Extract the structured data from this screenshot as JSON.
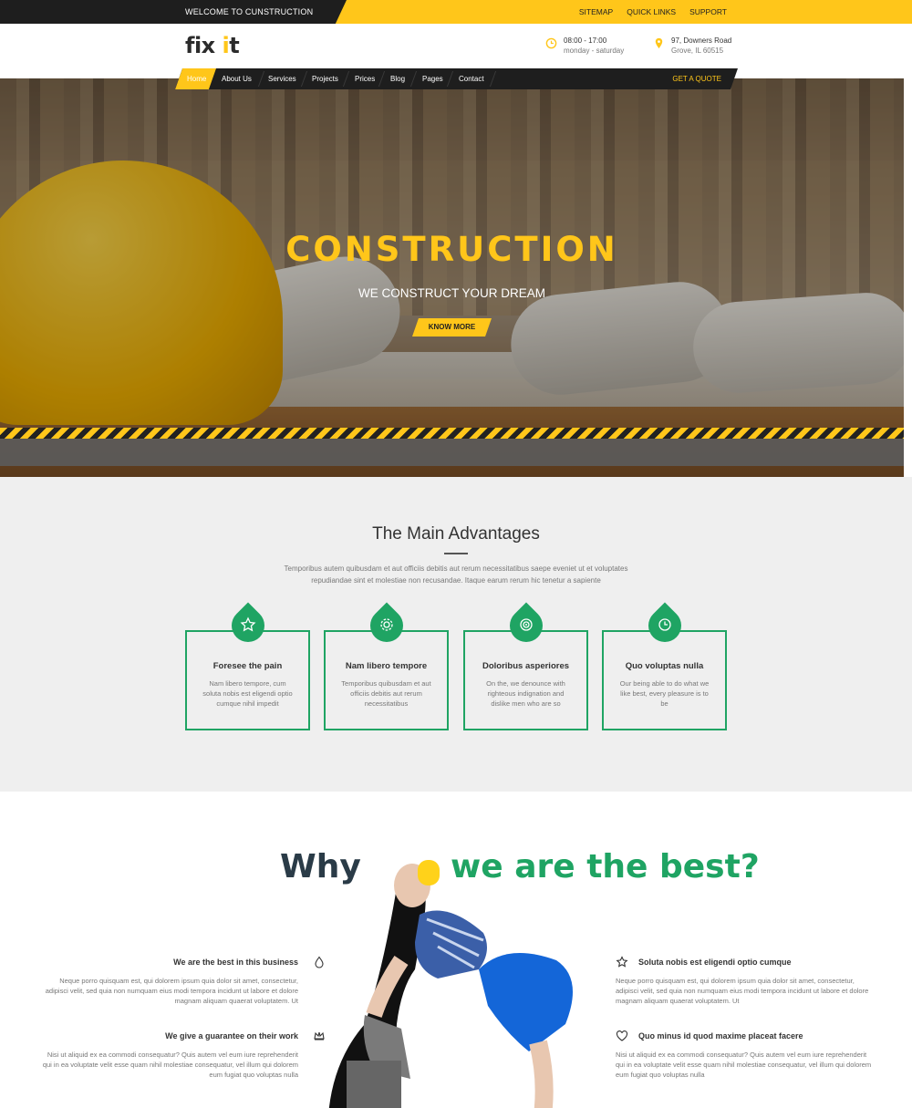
{
  "topbar": {
    "welcome": "WELCOME TO CUNSTRUCTION",
    "links": [
      "SITEMAP",
      "QUICK LINKS",
      "SUPPORT"
    ]
  },
  "header": {
    "logo_main": "fix ",
    "logo_i": "i",
    "logo_t": "t",
    "hours_line1": "08:00 - 17:00",
    "hours_line2": "monday - saturday",
    "address_line1": "97, Downers Road",
    "address_line2": "Grove, IL 60515"
  },
  "nav": {
    "items": [
      "Home",
      "About Us",
      "Services",
      "Projects",
      "Prices",
      "Blog",
      "Pages",
      "Contact"
    ],
    "quote": "GET A QUOTE"
  },
  "hero": {
    "title": "CONSTRUCTION",
    "subtitle": "WE CONSTRUCT YOUR DREAM",
    "button": "KNOW MORE"
  },
  "advantages": {
    "title": "The Main Advantages",
    "description": "Temporibus autem quibusdam et aut officiis debitis aut rerum necessitatibus saepe eveniet ut et voluptates repudiandae sint et molestiae non recusandae. Itaque earum rerum hic tenetur a sapiente",
    "cards": [
      {
        "icon": "star-icon",
        "title": "Foresee the pain",
        "text": "Nam libero tempore, cum soluta nobis est eligendi optio cumque nihil impedit"
      },
      {
        "icon": "gear-icon",
        "title": "Nam libero tempore",
        "text": "Temporibus quibusdam et aut officiis debitis aut rerum necessitatibus"
      },
      {
        "icon": "target-icon",
        "title": "Doloribus asperiores",
        "text": "On the, we denounce with righteous indignation and dislike men who are so"
      },
      {
        "icon": "clock-icon",
        "title": "Quo voluptas nulla",
        "text": "Our being able to do what we like best, every pleasure is to be"
      }
    ]
  },
  "why": {
    "title_part1": "Why",
    "title_part2": "we are the best?",
    "features_left": [
      {
        "icon": "drop-icon",
        "title": "We are the best in this business",
        "text": "Neque porro quisquam est, qui dolorem ipsum quia dolor sit amet, consectetur, adipisci velit, sed quia non numquam eius modi tempora incidunt ut labore et dolore magnam aliquam quaerat voluptatem. Ut"
      },
      {
        "icon": "crown-icon",
        "title": "We give a guarantee on their work",
        "text": "Nisi ut aliquid ex ea commodi consequatur? Quis autem vel eum iure reprehenderit qui in ea voluptate velit esse quam nihil molestiae consequatur, vel illum qui dolorem eum fugiat quo voluptas nulla"
      }
    ],
    "features_right": [
      {
        "icon": "star-outline-icon",
        "title": "Soluta nobis est eligendi optio cumque",
        "text": "Neque porro quisquam est, qui dolorem ipsum quia dolor sit amet, consectetur, adipisci velit, sed quia non numquam eius modi tempora incidunt ut labore et dolore magnam aliquam quaerat voluptatem. Ut"
      },
      {
        "icon": "heart-icon",
        "title": "Quo minus id quod maxime placeat facere",
        "text": "Nisi ut aliquid ex ea commodi consequatur? Quis autem vel eum iure reprehenderit qui in ea voluptate velit esse quam nihil molestiae consequatur, vel illum qui dolorem eum fugiat quo voluptas nulla"
      }
    ]
  },
  "colors": {
    "accent": "#ffc61a",
    "green": "#1fa463",
    "dark": "#1e1e1e"
  }
}
